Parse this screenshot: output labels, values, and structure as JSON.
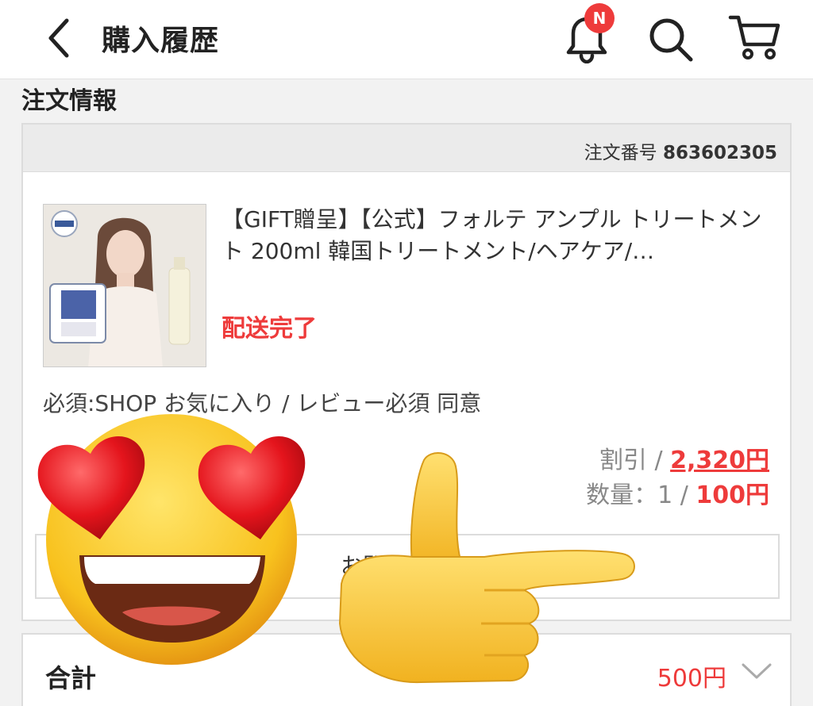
{
  "header": {
    "title": "購入履歴",
    "notification_badge": "N"
  },
  "section": {
    "title": "注文情報"
  },
  "order": {
    "number_label": "注文番号",
    "number": "863602305",
    "product_name": "【GIFT贈呈】【公式】フォルテ アンプル トリートメント 200ml 韓国トリートメント/ヘアケア/…",
    "status": "配送完了",
    "option": "必須:SHOP お気に入り / レビュー必須 同意",
    "discount_label": "割引 / ",
    "discount_value": "2,320円",
    "quantity_label": "数量：1 / ",
    "quantity_price": "100円",
    "inquiry_button": "お問い合わせ"
  },
  "total": {
    "label": "合計",
    "value": "500円"
  },
  "colors": {
    "accent": "#ee3b3b",
    "header_bg": "#ffffff",
    "page_bg": "#f2f2f2"
  },
  "icons": [
    "back-arrow-icon",
    "bell-icon",
    "search-icon",
    "cart-icon",
    "chevron-down-icon",
    "heart-eyes-emoji-sticker",
    "pointing-hand-emoji-sticker"
  ]
}
